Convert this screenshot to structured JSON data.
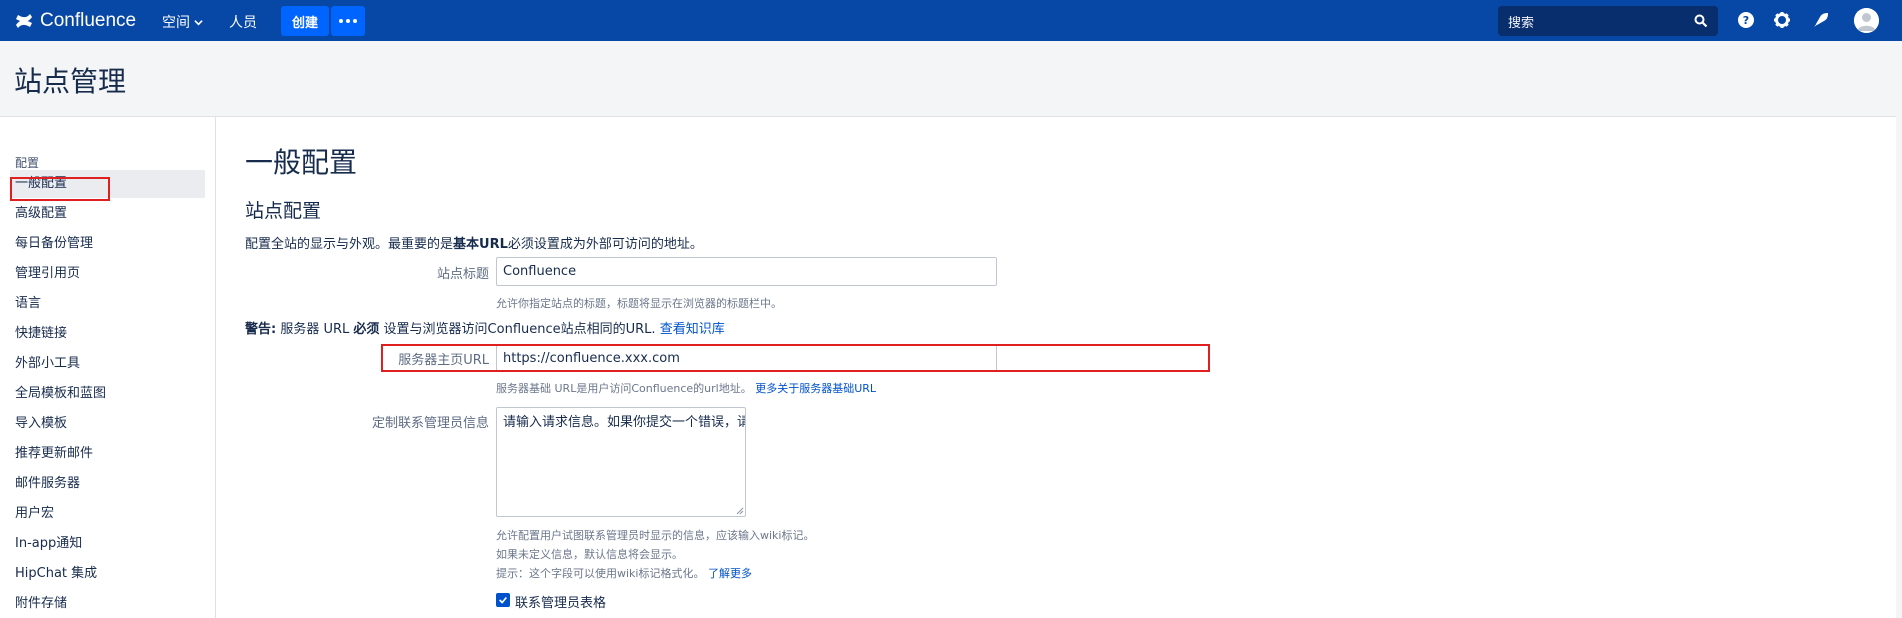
{
  "topnav": {
    "brand": "Confluence",
    "spaces_label": "空间",
    "people_label": "人员",
    "create_label": "创建",
    "search_placeholder": "搜索",
    "colors": {
      "bar": "#0747a6",
      "button": "#0065ff",
      "search_bg": "#092e6d"
    },
    "icons": [
      "confluence-logo-icon",
      "chevron-down-icon",
      "more-dots-icon",
      "search-icon",
      "help-icon",
      "gear-icon",
      "notifications-icon",
      "user-avatar-icon"
    ]
  },
  "page_header": {
    "title": "站点管理"
  },
  "sidebar": {
    "group_label": "配置",
    "items": [
      {
        "label": "一般配置",
        "active": true
      },
      {
        "label": "高级配置"
      },
      {
        "label": "每日备份管理"
      },
      {
        "label": "管理引用页"
      },
      {
        "label": "语言"
      },
      {
        "label": "快捷链接"
      },
      {
        "label": "外部小工具"
      },
      {
        "label": "全局模板和蓝图"
      },
      {
        "label": "导入模板"
      },
      {
        "label": "推荐更新邮件"
      },
      {
        "label": "邮件服务器"
      },
      {
        "label": "用户宏"
      },
      {
        "label": "In-app通知"
      },
      {
        "label": "HipChat 集成"
      },
      {
        "label": "附件存储"
      }
    ]
  },
  "main": {
    "heading": "一般配置",
    "section_title": "站点配置",
    "description": {
      "before": "配置全站的显示与外观。最重要的是",
      "bold": "基本URL",
      "after": "必须设置成为外部可访问的地址。"
    },
    "site_title": {
      "label": "站点标题",
      "value": "Confluence",
      "hint": "允许你指定站点的标题，标题将显示在浏览器的标题栏中。"
    },
    "warning": {
      "prefix": "警告:",
      "part1": " 服务器 URL ",
      "bold": "必须",
      "part2": " 设置与浏览器访问Confluence站点相同的URL.",
      "link": " 查看知识库"
    },
    "server_url": {
      "label": "服务器主页URL",
      "value": "https://confluence.xxx.com",
      "hint": "服务器基础 URL是用户访问Confluence的url地址。",
      "hint_link": "更多关于服务器基础URL"
    },
    "admin_message": {
      "label": "定制联系管理员信息",
      "value": "请输入请求信息。如果你提交一个错误，请附上错误信息与截图。",
      "hint1": "允许配置用户试图联系管理员时显示的信息，应该输入wiki标记。",
      "hint2": "如果未定义信息，默认信息将会显示。",
      "hint3": "提示：这个字段可以使用wiki标记格式化。",
      "hint3_link": "了解更多"
    },
    "contact_form": {
      "label": "联系管理员表格",
      "checked": true
    }
  }
}
